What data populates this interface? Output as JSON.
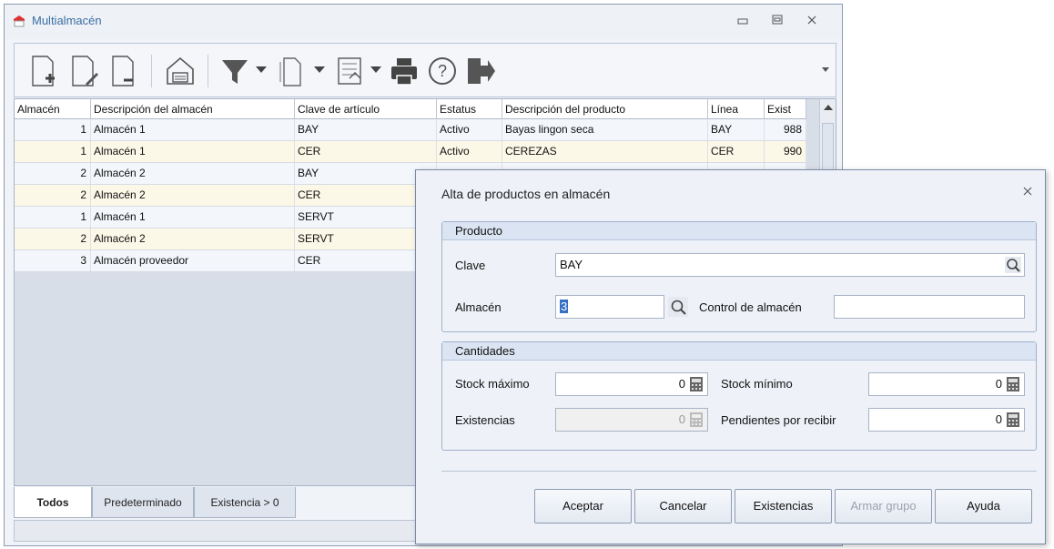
{
  "main_window": {
    "title": "Multialmacén",
    "controls": {
      "minimize": "▭",
      "maximize": "▫",
      "close": "✕"
    }
  },
  "toolbar": {
    "icons": [
      "new-document-icon",
      "edit-document-icon",
      "delete-document-icon",
      "warehouse-icon",
      "filter-icon",
      "copy-icon",
      "export-icon",
      "print-icon",
      "help-icon",
      "exit-icon"
    ]
  },
  "grid": {
    "columns": [
      "Almacén",
      "Descripción del almacén",
      "Clave de artículo",
      "Estatus",
      "Descripción del producto",
      "Línea",
      "Exist"
    ],
    "rows": [
      {
        "almacen": "1",
        "desc_almacen": "Almacén 1",
        "clave": "BAY",
        "estatus": "Activo",
        "desc_producto": "Bayas lingon seca",
        "linea": "BAY",
        "exist": "988"
      },
      {
        "almacen": "1",
        "desc_almacen": "Almacén 1",
        "clave": "CER",
        "estatus": "Activo",
        "desc_producto": "CEREZAS",
        "linea": "CER",
        "exist": "990"
      },
      {
        "almacen": "2",
        "desc_almacen": "Almacén 2",
        "clave": "BAY",
        "estatus": "",
        "desc_producto": "",
        "linea": "",
        "exist": ""
      },
      {
        "almacen": "2",
        "desc_almacen": "Almacén 2",
        "clave": "CER",
        "estatus": "",
        "desc_producto": "",
        "linea": "",
        "exist": ""
      },
      {
        "almacen": "1",
        "desc_almacen": "Almacén 1",
        "clave": "SERVT",
        "estatus": "",
        "desc_producto": "",
        "linea": "",
        "exist": ""
      },
      {
        "almacen": "2",
        "desc_almacen": "Almacén 2",
        "clave": "SERVT",
        "estatus": "",
        "desc_producto": "",
        "linea": "",
        "exist": ""
      },
      {
        "almacen": "3",
        "desc_almacen": "Almacén proveedor",
        "clave": "CER",
        "estatus": "",
        "desc_producto": "",
        "linea": "",
        "exist": ""
      }
    ]
  },
  "tabs": [
    "Todos",
    "Predeterminado",
    "Existencia > 0"
  ],
  "dialog": {
    "title": "Alta de productos en almacén",
    "close": "✕",
    "producto": {
      "header": "Producto",
      "clave_label": "Clave",
      "clave_value": "BAY",
      "almacen_label": "Almacén",
      "almacen_value": "3",
      "control_label": "Control de almacén",
      "control_value": ""
    },
    "cantidades": {
      "header": "Cantidades",
      "stock_max_label": "Stock máximo",
      "stock_max_value": "0",
      "stock_min_label": "Stock mínimo",
      "stock_min_value": "0",
      "existencias_label": "Existencias",
      "existencias_value": "0",
      "pendientes_label": "Pendientes por recibir",
      "pendientes_value": "0"
    },
    "buttons": {
      "aceptar": "Aceptar",
      "cancelar": "Cancelar",
      "existencias": "Existencias",
      "armar_grupo": "Armar grupo",
      "ayuda": "Ayuda"
    }
  }
}
